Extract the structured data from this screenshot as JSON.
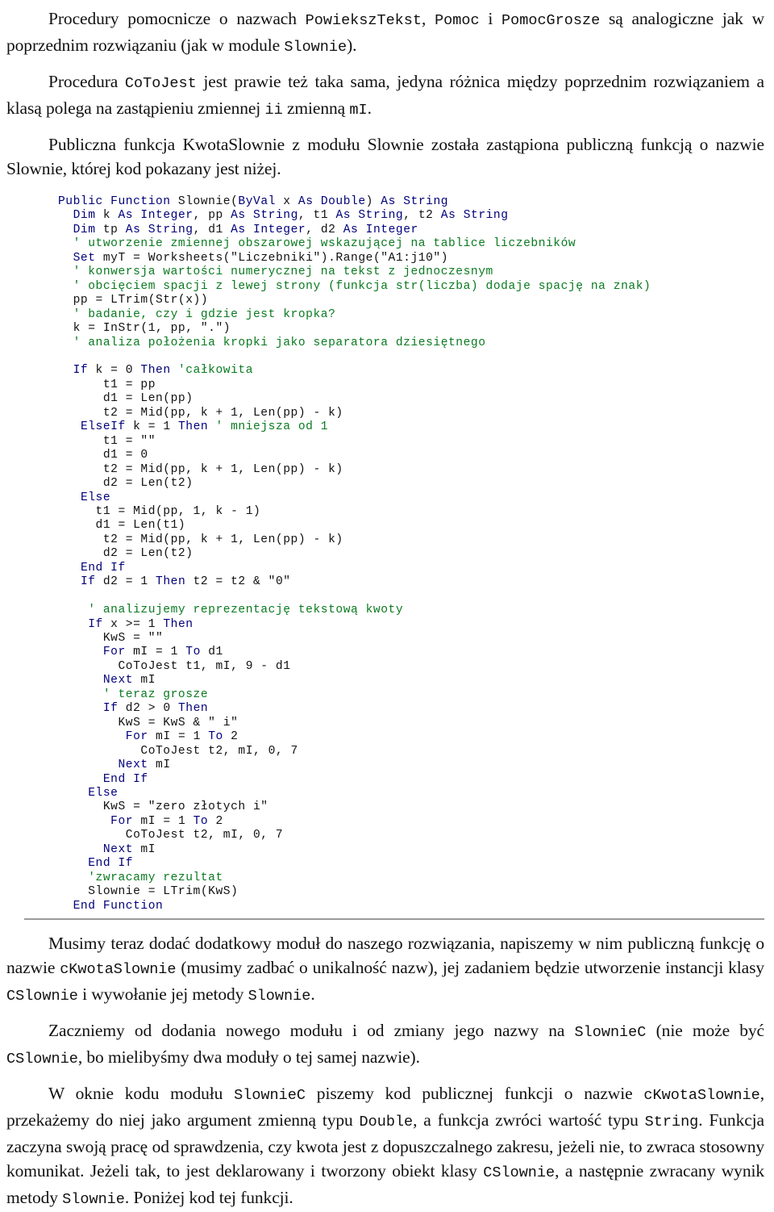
{
  "document": {
    "language": "pl",
    "colors": {
      "keyword": "#00007a",
      "comment": "#0a7a20",
      "identifier": "#111111",
      "rule": "#9b9b9b",
      "text": "#111111"
    },
    "paragraphs": [
      {
        "id": "para-1",
        "runs": [
          {
            "type": "text",
            "value": "Procedury pomocnicze o nazwach "
          },
          {
            "type": "code",
            "value": "PowiekszTekst"
          },
          {
            "type": "text",
            "value": ", "
          },
          {
            "type": "code",
            "value": "Pomoc"
          },
          {
            "type": "text",
            "value": " i "
          },
          {
            "type": "code",
            "value": "PomocGrosze"
          },
          {
            "type": "text",
            "value": " są analogiczne jak w poprzednim rozwiązaniu (jak w module "
          },
          {
            "type": "code",
            "value": "Slownie"
          },
          {
            "type": "text",
            "value": ")."
          }
        ]
      },
      {
        "id": "para-2",
        "runs": [
          {
            "type": "text",
            "value": "Procedura "
          },
          {
            "type": "code",
            "value": "CoToJest"
          },
          {
            "type": "text",
            "value": " jest prawie też taka sama, jedyna różnica między poprzednim rozwiązaniem a klasą polega na zastąpieniu zmiennej "
          },
          {
            "type": "code",
            "value": "ii"
          },
          {
            "type": "text",
            "value": " zmienną "
          },
          {
            "type": "code",
            "value": "mI"
          },
          {
            "type": "text",
            "value": "."
          }
        ]
      },
      {
        "id": "para-3",
        "runs": [
          {
            "type": "text",
            "value": "Publiczna funkcja KwotaSlownie z modułu Slownie została zastąpiona publiczną funkcją o nazwie Slownie, której kod pokazany jest niżej."
          }
        ]
      }
    ],
    "code_block": {
      "id": "code-slownie",
      "language": "VBA",
      "lines": [
        [
          {
            "t": "kw",
            "v": "Public Function"
          },
          {
            "t": "idn",
            "v": " Slownie("
          },
          {
            "t": "kw",
            "v": "ByVal"
          },
          {
            "t": "idn",
            "v": " x "
          },
          {
            "t": "kw",
            "v": "As Double"
          },
          {
            "t": "idn",
            "v": ") "
          },
          {
            "t": "kw",
            "v": "As String"
          }
        ],
        [
          {
            "t": "idn",
            "v": "  "
          },
          {
            "t": "kw",
            "v": "Dim"
          },
          {
            "t": "idn",
            "v": " k "
          },
          {
            "t": "kw",
            "v": "As Integer"
          },
          {
            "t": "idn",
            "v": ", pp "
          },
          {
            "t": "kw",
            "v": "As String"
          },
          {
            "t": "idn",
            "v": ", t1 "
          },
          {
            "t": "kw",
            "v": "As String"
          },
          {
            "t": "idn",
            "v": ", t2 "
          },
          {
            "t": "kw",
            "v": "As String"
          }
        ],
        [
          {
            "t": "idn",
            "v": "  "
          },
          {
            "t": "kw",
            "v": "Dim"
          },
          {
            "t": "idn",
            "v": " tp "
          },
          {
            "t": "kw",
            "v": "As String"
          },
          {
            "t": "idn",
            "v": ", d1 "
          },
          {
            "t": "kw",
            "v": "As Integer"
          },
          {
            "t": "idn",
            "v": ", d2 "
          },
          {
            "t": "kw",
            "v": "As Integer"
          }
        ],
        [
          {
            "t": "cmt",
            "v": "  ' utworzenie zmiennej obszarowej wskazującej na tablice liczebników"
          }
        ],
        [
          {
            "t": "idn",
            "v": "  "
          },
          {
            "t": "kw",
            "v": "Set"
          },
          {
            "t": "idn",
            "v": " myT = Worksheets(\"Liczebniki\").Range(\"A1:j10\")"
          }
        ],
        [
          {
            "t": "cmt",
            "v": "  ' konwersja wartości numerycznej na tekst z jednoczesnym"
          }
        ],
        [
          {
            "t": "cmt",
            "v": "  ' obcięciem spacji z lewej strony (funkcja str(liczba) dodaje spację na znak)"
          }
        ],
        [
          {
            "t": "idn",
            "v": "  pp = LTrim(Str(x))"
          }
        ],
        [
          {
            "t": "cmt",
            "v": "  ' badanie, czy i gdzie jest kropka?"
          }
        ],
        [
          {
            "t": "idn",
            "v": "  k = InStr(1, pp, \".\")"
          }
        ],
        [
          {
            "t": "cmt",
            "v": "  ' analiza położenia kropki jako separatora dziesiętnego"
          }
        ],
        [],
        [
          {
            "t": "idn",
            "v": "  "
          },
          {
            "t": "kw",
            "v": "If"
          },
          {
            "t": "idn",
            "v": " k = 0 "
          },
          {
            "t": "kw",
            "v": "Then"
          },
          {
            "t": "cmt",
            "v": " 'całkowita"
          }
        ],
        [
          {
            "t": "idn",
            "v": "      t1 = pp"
          }
        ],
        [
          {
            "t": "idn",
            "v": "      d1 = Len(pp)"
          }
        ],
        [
          {
            "t": "idn",
            "v": "      t2 = Mid(pp, k + 1, Len(pp) - k)"
          }
        ],
        [
          {
            "t": "idn",
            "v": "   "
          },
          {
            "t": "kw",
            "v": "ElseIf"
          },
          {
            "t": "idn",
            "v": " k = 1 "
          },
          {
            "t": "kw",
            "v": "Then"
          },
          {
            "t": "cmt",
            "v": " ' mniejsza od 1"
          }
        ],
        [
          {
            "t": "idn",
            "v": "      t1 = \"\""
          }
        ],
        [
          {
            "t": "idn",
            "v": "      d1 = 0"
          }
        ],
        [
          {
            "t": "idn",
            "v": "      t2 = Mid(pp, k + 1, Len(pp) - k)"
          }
        ],
        [
          {
            "t": "idn",
            "v": "      d2 = Len(t2)"
          }
        ],
        [
          {
            "t": "idn",
            "v": "   "
          },
          {
            "t": "kw",
            "v": "Else"
          }
        ],
        [
          {
            "t": "idn",
            "v": "     t1 = Mid(pp, 1, k - 1)"
          }
        ],
        [
          {
            "t": "idn",
            "v": "     d1 = Len(t1)"
          }
        ],
        [
          {
            "t": "idn",
            "v": "      t2 = Mid(pp, k + 1, Len(pp) - k)"
          }
        ],
        [
          {
            "t": "idn",
            "v": "      d2 = Len(t2)"
          }
        ],
        [
          {
            "t": "idn",
            "v": "   "
          },
          {
            "t": "kw",
            "v": "End If"
          }
        ],
        [
          {
            "t": "idn",
            "v": "   "
          },
          {
            "t": "kw",
            "v": "If"
          },
          {
            "t": "idn",
            "v": " d2 = 1 "
          },
          {
            "t": "kw",
            "v": "Then"
          },
          {
            "t": "idn",
            "v": " t2 = t2 & \"0\""
          }
        ],
        [],
        [
          {
            "t": "cmt",
            "v": "    ' analizujemy reprezentację tekstową kwoty"
          }
        ],
        [
          {
            "t": "idn",
            "v": "    "
          },
          {
            "t": "kw",
            "v": "If"
          },
          {
            "t": "idn",
            "v": " x >= 1 "
          },
          {
            "t": "kw",
            "v": "Then"
          }
        ],
        [
          {
            "t": "idn",
            "v": "      KwS = \"\""
          }
        ],
        [
          {
            "t": "idn",
            "v": "      "
          },
          {
            "t": "kw",
            "v": "For"
          },
          {
            "t": "idn",
            "v": " mI = 1 "
          },
          {
            "t": "kw",
            "v": "To"
          },
          {
            "t": "idn",
            "v": " d1"
          }
        ],
        [
          {
            "t": "idn",
            "v": "        CoToJest t1, mI, 9 - d1"
          }
        ],
        [
          {
            "t": "idn",
            "v": "      "
          },
          {
            "t": "kw",
            "v": "Next"
          },
          {
            "t": "idn",
            "v": " mI"
          }
        ],
        [
          {
            "t": "cmt",
            "v": "      ' teraz grosze"
          }
        ],
        [
          {
            "t": "idn",
            "v": "      "
          },
          {
            "t": "kw",
            "v": "If"
          },
          {
            "t": "idn",
            "v": " d2 > 0 "
          },
          {
            "t": "kw",
            "v": "Then"
          }
        ],
        [
          {
            "t": "idn",
            "v": "        KwS = KwS & \" i\""
          }
        ],
        [
          {
            "t": "idn",
            "v": "         "
          },
          {
            "t": "kw",
            "v": "For"
          },
          {
            "t": "idn",
            "v": " mI = 1 "
          },
          {
            "t": "kw",
            "v": "To"
          },
          {
            "t": "idn",
            "v": " 2"
          }
        ],
        [
          {
            "t": "idn",
            "v": "           CoToJest t2, mI, 0, 7"
          }
        ],
        [
          {
            "t": "idn",
            "v": "        "
          },
          {
            "t": "kw",
            "v": "Next"
          },
          {
            "t": "idn",
            "v": " mI"
          }
        ],
        [
          {
            "t": "idn",
            "v": "      "
          },
          {
            "t": "kw",
            "v": "End If"
          }
        ],
        [
          {
            "t": "idn",
            "v": "    "
          },
          {
            "t": "kw",
            "v": "Else"
          }
        ],
        [
          {
            "t": "idn",
            "v": "      KwS = \"zero złotych i\""
          }
        ],
        [
          {
            "t": "idn",
            "v": "       "
          },
          {
            "t": "kw",
            "v": "For"
          },
          {
            "t": "idn",
            "v": " mI = 1 "
          },
          {
            "t": "kw",
            "v": "To"
          },
          {
            "t": "idn",
            "v": " 2"
          }
        ],
        [
          {
            "t": "idn",
            "v": "         CoToJest t2, mI, 0, 7"
          }
        ],
        [
          {
            "t": "idn",
            "v": "      "
          },
          {
            "t": "kw",
            "v": "Next"
          },
          {
            "t": "idn",
            "v": " mI"
          }
        ],
        [
          {
            "t": "idn",
            "v": "    "
          },
          {
            "t": "kw",
            "v": "End If"
          }
        ],
        [
          {
            "t": "cmt",
            "v": "    'zwracamy rezultat"
          }
        ],
        [
          {
            "t": "idn",
            "v": "    Slownie = LTrim(KwS)"
          }
        ],
        [
          {
            "t": "kw",
            "v": "  End Function"
          }
        ]
      ]
    },
    "paragraphs_after": [
      {
        "id": "para-4",
        "runs": [
          {
            "type": "text",
            "value": "Musimy teraz dodać dodatkowy moduł do naszego rozwiązania, napiszemy w nim publiczną funkcję o nazwie "
          },
          {
            "type": "code",
            "value": "cKwotaSlownie"
          },
          {
            "type": "text",
            "value": " (musimy zadbać o unikalność nazw), jej zadaniem będzie utworzenie instancji klasy "
          },
          {
            "type": "code",
            "value": "CSlownie"
          },
          {
            "type": "text",
            "value": " i wywołanie jej metody "
          },
          {
            "type": "code",
            "value": "Slownie"
          },
          {
            "type": "text",
            "value": "."
          }
        ]
      },
      {
        "id": "para-5",
        "runs": [
          {
            "type": "text",
            "value": "Zaczniemy od dodania nowego modułu i od zmiany jego nazwy na "
          },
          {
            "type": "code",
            "value": "SlownieC"
          },
          {
            "type": "text",
            "value": " (nie może być "
          },
          {
            "type": "code",
            "value": "CSlownie"
          },
          {
            "type": "text",
            "value": ", bo mielibyśmy dwa moduły o tej samej nazwie)."
          }
        ]
      },
      {
        "id": "para-6",
        "runs": [
          {
            "type": "text",
            "value": "W oknie kodu modułu "
          },
          {
            "type": "code",
            "value": "SlownieC"
          },
          {
            "type": "text",
            "value": " piszemy kod publicznej funkcji o nazwie "
          },
          {
            "type": "code",
            "value": "cKwotaSlownie"
          },
          {
            "type": "text",
            "value": ", przekażemy do niej jako argument zmienną typu "
          },
          {
            "type": "code",
            "value": "Double"
          },
          {
            "type": "text",
            "value": ", a funkcja zwróci wartość typu "
          },
          {
            "type": "code",
            "value": "String"
          },
          {
            "type": "text",
            "value": ". Funkcja zaczyna swoją pracę od sprawdzenia, czy kwota jest z dopuszczalnego zakresu, jeżeli nie, to zwraca stosowny komunikat. Jeżeli tak, to jest deklarowany i tworzony obiekt klasy "
          },
          {
            "type": "code",
            "value": "CSlownie"
          },
          {
            "type": "text",
            "value": ", a następnie zwracany wynik metody "
          },
          {
            "type": "code",
            "value": "Slownie"
          },
          {
            "type": "text",
            "value": ". Poniżej kod tej funkcji."
          }
        ]
      }
    ]
  }
}
